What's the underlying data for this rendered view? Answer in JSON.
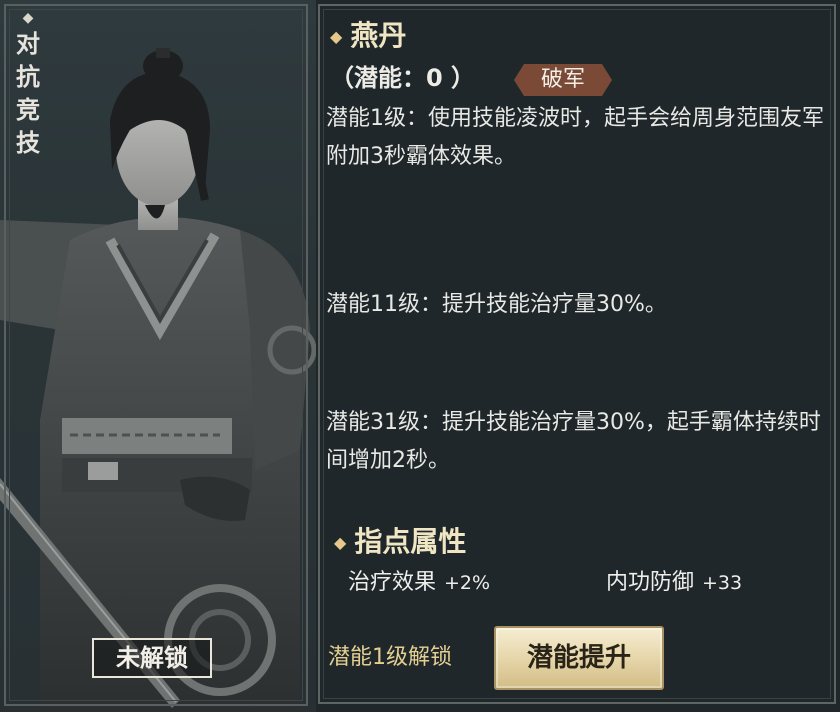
{
  "left_panel": {
    "vertical_label": "对\n抗\n竞\n技",
    "lock_label": "未解锁"
  },
  "skill": {
    "name": "燕丹",
    "potential_text": "（潜能：0 ）",
    "faction_tag": "破军",
    "levels": [
      "潜能1级：使用技能凌波时，起手会给周身范围友军附加3秒霸体效果。",
      "潜能11级：提升技能治疗量30%。",
      "潜能31级：提升技能治疗量30%，起手霸体持续时间增加2秒。"
    ]
  },
  "attributes": {
    "title": "指点属性",
    "items": [
      {
        "name": "治疗效果",
        "value": "+2%"
      },
      {
        "name": "内功防御",
        "value": "+33"
      }
    ]
  },
  "footer": {
    "unlock_text": "潜能1级解锁",
    "upgrade_button": "潜能提升"
  },
  "colors": {
    "title_gold": "#f0e6c4",
    "accent_gold": "#e4cf91",
    "tag_brown": "#7a4a37",
    "button_gold": "#e6d6aa"
  },
  "icons": [
    "diamond-icon"
  ]
}
